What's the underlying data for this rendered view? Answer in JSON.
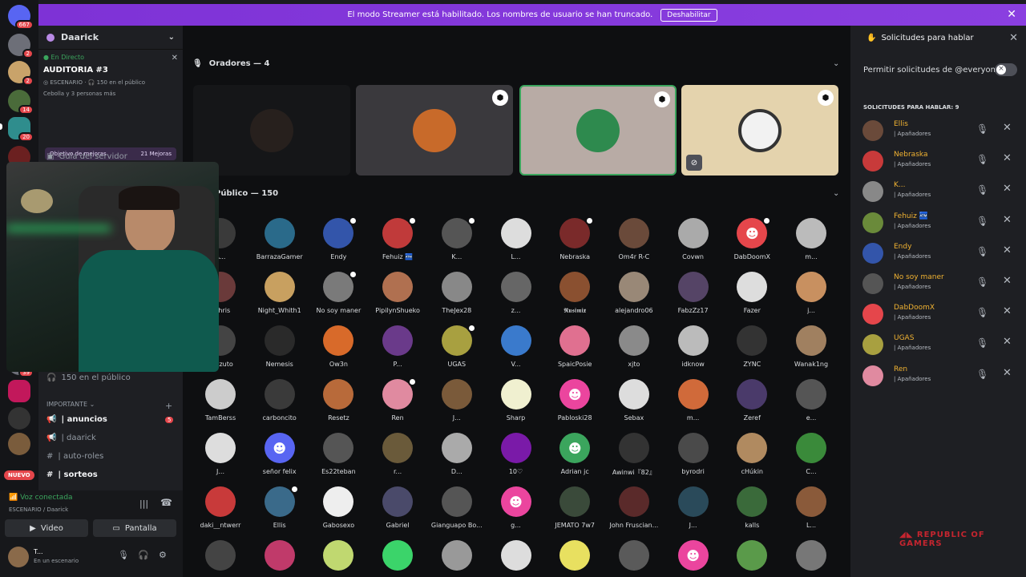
{
  "banner": {
    "text": "El modo Streamer está habilitado. Los nombres de usuario se han truncado.",
    "button": "Deshabilitar"
  },
  "rail": {
    "badges": [
      "667",
      "2",
      "2",
      "14",
      "20",
      "39"
    ],
    "nuevo": "NUEVO"
  },
  "server": {
    "name": "Daarick"
  },
  "event": {
    "status": "En Directo",
    "title": "AUDITORIA #3",
    "stage_tag": "ESCENARIO",
    "audience": "150 en el público",
    "people": "Cebolla y 3 personas más"
  },
  "goal": {
    "label": "Objetivo de mejoras",
    "count": "21 Mejoras"
  },
  "channels": {
    "guide": "Guía del servidor",
    "audience_line": "150 en el público",
    "category": "IMPORTANTE",
    "items": [
      {
        "label": "| anuncios",
        "badge": "5"
      },
      {
        "label": "| daarick"
      },
      {
        "label": "| auto-roles"
      },
      {
        "label": "| sorteos"
      }
    ]
  },
  "voice": {
    "status": "Voz conectada",
    "sub": "ESCENARIO / Daarick",
    "video": "Video",
    "screen": "Pantalla"
  },
  "user": {
    "name": "T...",
    "status": "En un escenario"
  },
  "stage": {
    "speakers_title": "Oradores — 4",
    "audience_title": "Público — 150"
  },
  "audience": [
    "A...",
    "BarrazaGamer",
    "Endy",
    "Fehuiz 🏧",
    "K...",
    "L...",
    "Nebraska",
    "Om4r R-C",
    "Covwn",
    "DabDoomX",
    "m...",
    "ekhris",
    "Night_Whith1",
    "No soy maner",
    "PipilynShueko",
    "TheJex28",
    "z...",
    "𝕽𝖚𝖘𝖎𝖒𝖎𝖝",
    "alejandro06",
    "FabzZz17",
    "Fazer",
    "j...",
    "Kazzuto",
    "Nemesis",
    "Ow3n",
    "P...",
    "UGAS",
    "V...",
    "SpaicPosie",
    "xjto",
    "idknow",
    "ZYNC",
    "Wanak1ng",
    "TamBerss",
    "carboncito",
    "Resetz",
    "Ren",
    "J...",
    "Sharp",
    "Pabloski28",
    "Sebax",
    "m...",
    "Zeref",
    "e...",
    "J...",
    "señor felix",
    "Es22teban",
    "r...",
    "D...",
    "10♡",
    "Adrian jc",
    "Awinwi『82』",
    "byrodri",
    "cHúkin",
    "C...",
    "daki__ntwerr",
    "Ellis",
    "Gabosexo",
    "Gabriel",
    "Gianguapo Bo...",
    "g...",
    "JEMATO 7w7",
    "John Fruscian...",
    "J...",
    "kalls",
    "L...",
    "",
    "",
    "",
    "",
    "",
    "",
    "",
    "",
    "",
    "",
    ""
  ],
  "requests": {
    "title": "Solicitudes para hablar",
    "permit": "Permitir solicitudes de @everyone",
    "count_label": "SOLICITUDES PARA HABLAR: 9",
    "role": "| Apañadores",
    "items": [
      "Ellis",
      "Nebraska",
      "K...",
      "Fehuiz 🏧",
      "Endy",
      "No soy maner",
      "DabDoomX",
      "UGAS",
      "Ren"
    ]
  },
  "rog": "REPUBLIC OF\nGAMERS"
}
